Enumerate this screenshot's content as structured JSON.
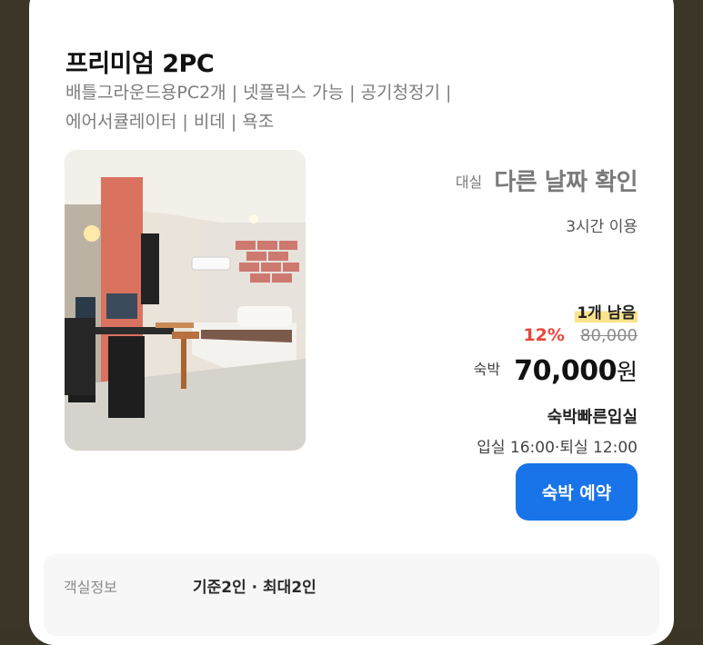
{
  "room": {
    "title": "프리미엄 2PC",
    "amenities_line1": "배틀그라운드용PC2개 | 넷플릭스 가능 | 공기청정기 |",
    "amenities_line2": "에어서큘레이터 | 비데 | 욕조"
  },
  "dayuse": {
    "label": "대실",
    "value": "다른 날짜 확인",
    "duration": "3시간 이용"
  },
  "stay": {
    "stock_badge": "1개 남음",
    "discount": "12%",
    "original_price": "80,000",
    "label": "숙박",
    "price": "70,000",
    "currency_unit": "원",
    "early_checkin_title": "숙박빠른입실",
    "checkin_times": "입실 16:00·퇴실 12:00",
    "book_button": "숙박 예약"
  },
  "info": {
    "label": "객실정보",
    "value": "기준2인 · 최대2인"
  },
  "colors": {
    "accent_blue": "#1874e8",
    "discount_red": "#e8463d",
    "badge_yellow": "#fbe38b",
    "backdrop": "#3b3627"
  }
}
